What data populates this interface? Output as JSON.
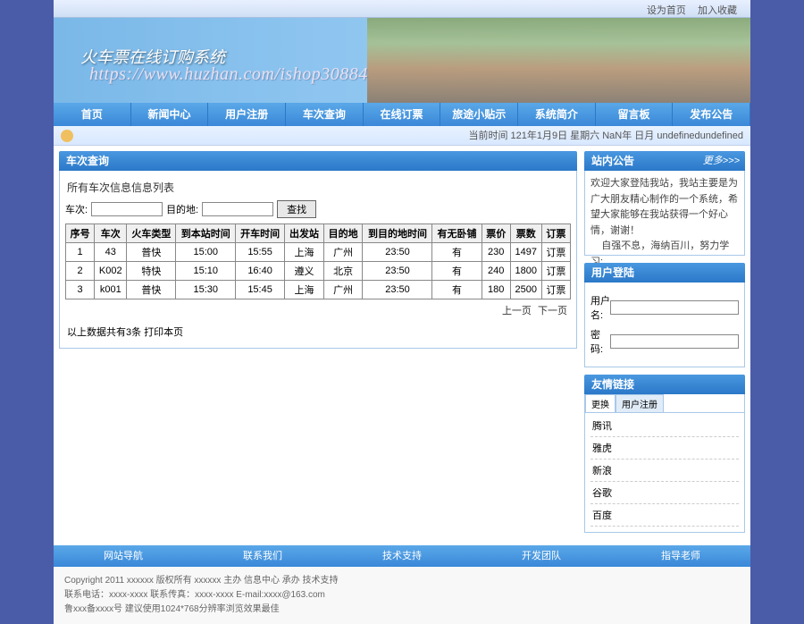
{
  "top_links": {
    "home": "设为首页",
    "fav": "加入收藏"
  },
  "banner": {
    "title": "火车票在线订购系统",
    "url": "https://www.huzhan.com/ishop30884"
  },
  "nav": [
    "首页",
    "新闻中心",
    "用户注册",
    "车次查询",
    "在线订票",
    "旅途小贴示",
    "系统简介",
    "留言板",
    "发布公告"
  ],
  "time_bar": {
    "label": "当前时间",
    "value": "121年1月9日 星期六 NaN年 日月 undefinedundefined"
  },
  "query_panel": {
    "title": "车次查询",
    "subtitle": "所有车次信息信息列表",
    "search": {
      "label1": "车次:",
      "label2": "目的地:",
      "btn": "查找"
    },
    "headers": [
      "序号",
      "车次",
      "火车类型",
      "到本站时间",
      "开车时间",
      "出发站",
      "目的地",
      "到目的地时间",
      "有无卧铺",
      "票价",
      "票数",
      "订票"
    ],
    "rows": [
      [
        "1",
        "43",
        "普快",
        "15:00",
        "15:55",
        "上海",
        "广州",
        "23:50",
        "有",
        "230",
        "1497",
        "订票"
      ],
      [
        "2",
        "K002",
        "特快",
        "15:10",
        "16:40",
        "遵义",
        "北京",
        "23:50",
        "有",
        "240",
        "1800",
        "订票"
      ],
      [
        "3",
        "k001",
        "普快",
        "15:30",
        "15:45",
        "上海",
        "广州",
        "23:50",
        "有",
        "180",
        "2500",
        "订票"
      ]
    ],
    "pager": {
      "prev": "上一页",
      "next": "下一页"
    },
    "summary": "以上数据共有3条 打印本页"
  },
  "notice": {
    "title": "站内公告",
    "more": "更多>>>",
    "body": "欢迎大家登陆我站，我站主要是为广大朋友精心制作的一个系统，希望大家能够在我站获得一个好心情，谢谢！\n    自强不息，海纳百川，努力学习:"
  },
  "login": {
    "title": "用户登陆",
    "user": "用户名:",
    "pass": "密码:"
  },
  "links": {
    "title": "友情链接",
    "tab1": "更换",
    "tab2": "用户注册",
    "items": [
      "腾讯",
      "雅虎",
      "新浪",
      "谷歌",
      "百度"
    ]
  },
  "footer_nav": [
    "网站导航",
    "联系我们",
    "技术支持",
    "开发团队",
    "指导老师"
  ],
  "footer": {
    "l1": "Copyright 2011 xxxxxx 版权所有 xxxxxx 主办 信息中心 承办 技术支持",
    "l2": "联系电话：xxxx-xxxx 联系传真：xxxx-xxxx E-mail:xxxx@163.com",
    "l3": "鲁xxx备xxxx号    建议使用1024*768分辨率浏览效果最佳"
  }
}
